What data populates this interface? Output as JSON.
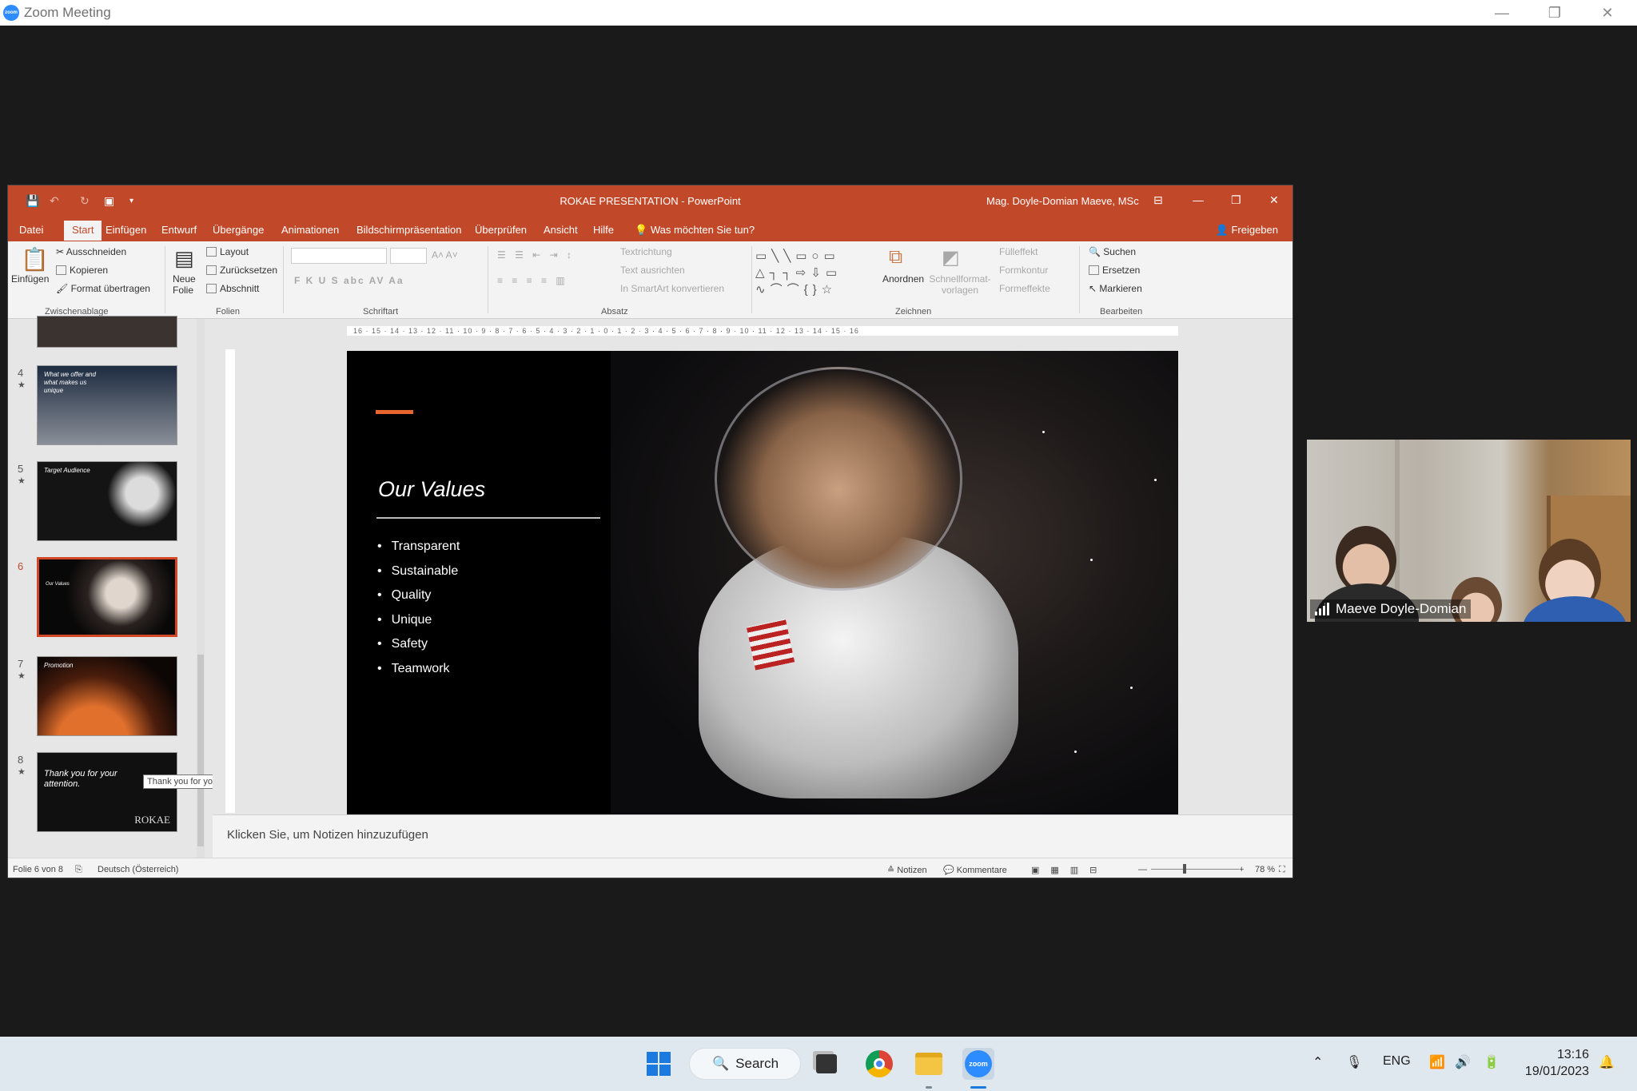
{
  "zoom": {
    "title": "Zoom Meeting",
    "logo_text": "zoom"
  },
  "ppt": {
    "title": "ROKAE PRESENTATION  -  PowerPoint",
    "user": "Mag. Doyle-Domian Maeve, MSc",
    "share": "Freigeben",
    "tabs": [
      "Datei",
      "Start",
      "Einfügen",
      "Entwurf",
      "Übergänge",
      "Animationen",
      "Bildschirmpräsentation",
      "Überprüfen",
      "Ansicht",
      "Hilfe"
    ],
    "tell_me": "Was möchten Sie tun?",
    "ribbon": {
      "paste": "Einfügen",
      "cut": "Ausschneiden",
      "copy": "Kopieren",
      "format_painter": "Format übertragen",
      "new_slide": "Neue Folie",
      "layout": "Layout",
      "reset": "Zurücksetzen",
      "section": "Abschnitt",
      "text_direction": "Textrichtung",
      "align_text": "Text ausrichten",
      "smartart": "In SmartArt konvertieren",
      "arrange": "Anordnen",
      "quick_styles": "Schnellformat-vorlagen",
      "shape_fill": "Fülleffekt",
      "shape_outline": "Formkontur",
      "shape_effects": "Formeffekte",
      "find": "Suchen",
      "replace": "Ersetzen",
      "select": "Markieren",
      "font_buttons": "F  K  U  S  abc  AV  Aa",
      "groups": [
        "Zwischenablage",
        "Folien",
        "Schriftart",
        "Absatz",
        "Zeichnen",
        "Bearbeiten"
      ]
    },
    "thumbnails": [
      {
        "num": "4",
        "text": "What we offer and what makes us unique"
      },
      {
        "num": "5",
        "text": "Target Audience"
      },
      {
        "num": "6",
        "text": "Our Values"
      },
      {
        "num": "7",
        "text": "Promotion"
      },
      {
        "num": "8",
        "text": "Thank you for your attention."
      }
    ],
    "thumb8_brand": "ROKAE",
    "tooltip": "Thank you for your attention.",
    "ruler_h": "16 · 15 · 14 · 13 · 12 · 11 · 10 · 9 · 8 · 7 · 6 · 5 · 4 · 3 · 2 · 1 · 0 · 1 · 2 · 3 · 4 · 5 · 6 · 7 · 8 · 9 · 10 · 11 · 12 · 13 · 14 · 15 · 16",
    "slide": {
      "title": "Our Values",
      "bullets": [
        "Transparent",
        "Sustainable",
        "Quality",
        "Unique",
        "Safety",
        "Teamwork"
      ]
    },
    "notes_placeholder": "Klicken Sie, um Notizen hinzuzufügen",
    "status": {
      "slide_pos": "Folie 6 von 8",
      "language": "Deutsch (Österreich)",
      "notes": "Notizen",
      "comments": "Kommentare",
      "zoom": "78 %"
    }
  },
  "participant": {
    "name": "Maeve Doyle-Domian"
  },
  "taskbar": {
    "search_label": "Search",
    "language": "ENG",
    "time": "13:16",
    "date": "19/01/2023",
    "zoom_icon_text": "zoom"
  },
  "colors": {
    "ppt_accent": "#c1492a",
    "slide_accent": "#e8662e",
    "zoom_blue": "#2d8cff",
    "taskbar_bg": "#dfe7ef"
  }
}
